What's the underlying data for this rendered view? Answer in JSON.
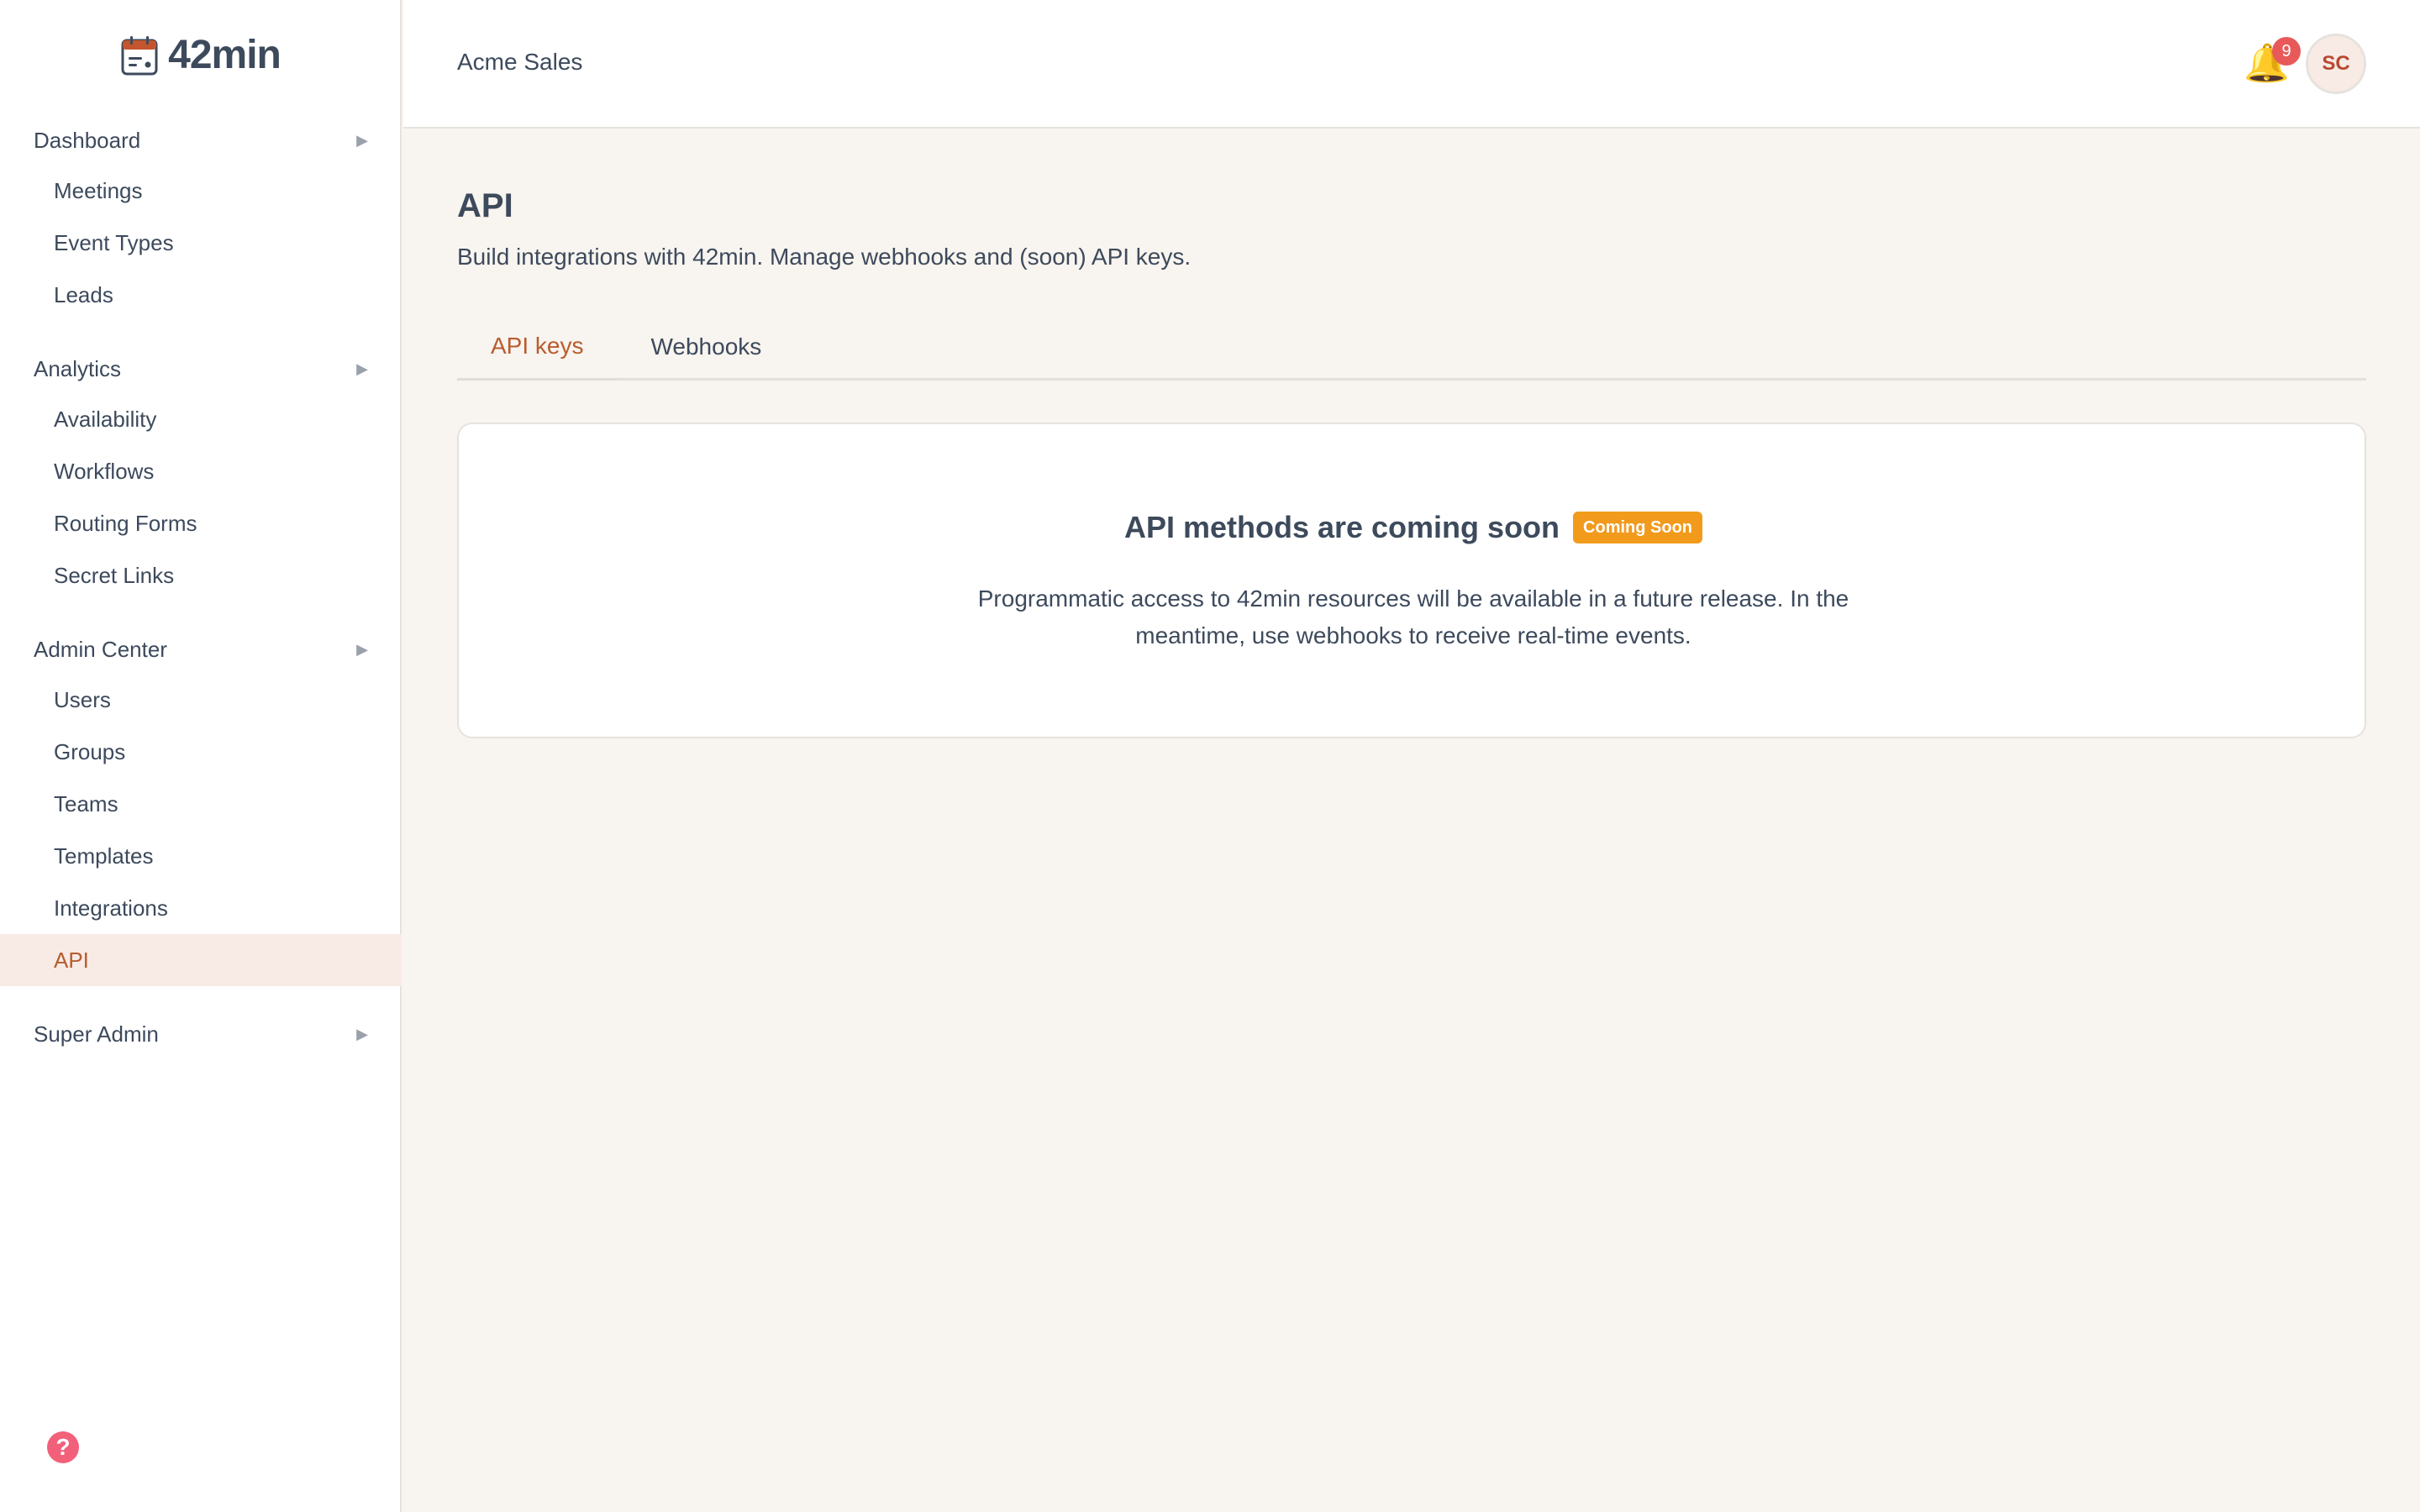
{
  "app": {
    "logo_text": "42min"
  },
  "sidebar": {
    "groups": [
      {
        "label": "Dashboard",
        "items": [
          {
            "label": "Meetings"
          },
          {
            "label": "Event Types"
          },
          {
            "label": "Leads"
          }
        ]
      },
      {
        "label": "Analytics",
        "items": [
          {
            "label": "Availability"
          },
          {
            "label": "Workflows"
          },
          {
            "label": "Routing Forms"
          },
          {
            "label": "Secret Links"
          }
        ]
      },
      {
        "label": "Admin Center",
        "items": [
          {
            "label": "Users"
          },
          {
            "label": "Groups"
          },
          {
            "label": "Teams"
          },
          {
            "label": "Templates"
          },
          {
            "label": "Integrations"
          },
          {
            "label": "API"
          }
        ]
      },
      {
        "label": "Super Admin",
        "items": []
      }
    ],
    "active_item": "API",
    "help_icon": "?"
  },
  "header": {
    "org_name": "Acme Sales",
    "notification_count": "9",
    "avatar_initials": "SC"
  },
  "main": {
    "title": "API",
    "subtitle": "Build integrations with 42min. Manage webhooks and (soon) API keys.",
    "tabs": [
      {
        "label": "API keys",
        "active": true
      },
      {
        "label": "Webhooks",
        "active": false
      }
    ],
    "card": {
      "title": "API methods are coming soon",
      "badge": "Coming Soon",
      "text": "Programmatic access to 42min resources will be available in a future release. In the meantime, use webhooks to receive real-time events."
    }
  },
  "colors": {
    "accent": "#b85c2e",
    "badge": "#f29a1c",
    "notification": "#e85a5a",
    "help": "#f2607a",
    "background": "#f8f4ef"
  }
}
